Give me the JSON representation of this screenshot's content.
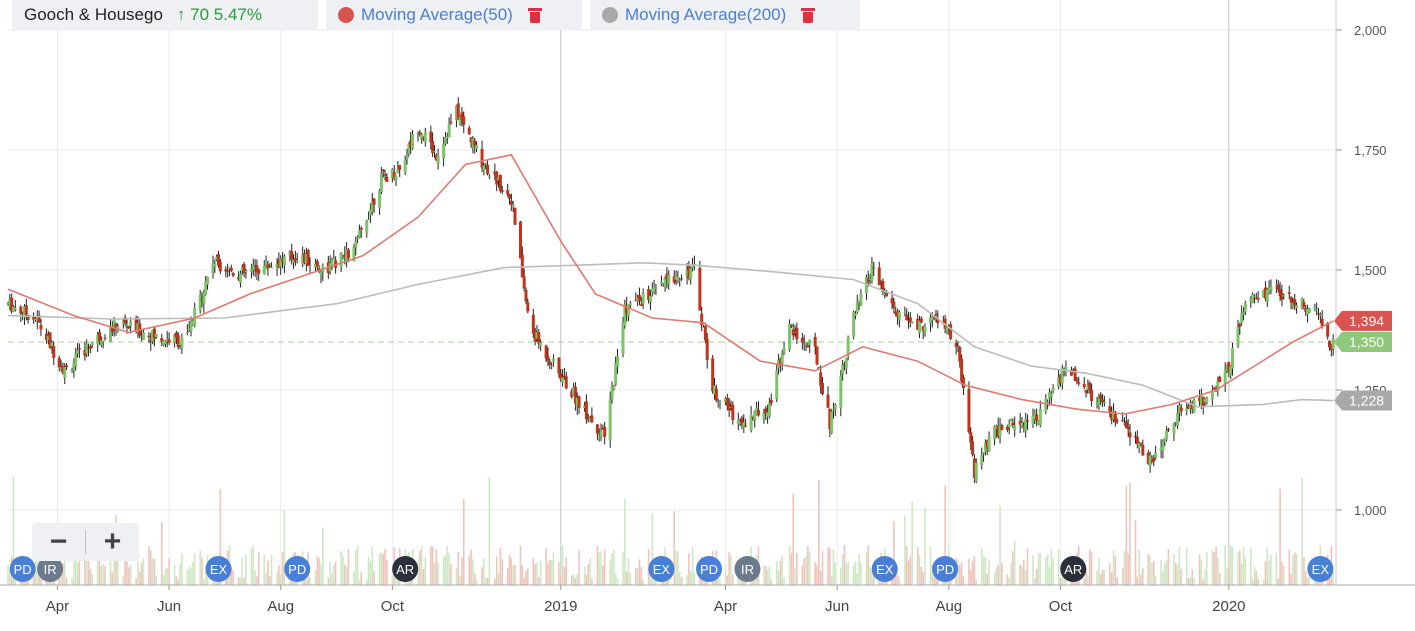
{
  "header": {
    "symbol": "Gooch & Housego",
    "change": "↑ 70 5.47%",
    "ma50_label": "Moving Average(50)",
    "ma200_label": "Moving Average(200)"
  },
  "colors": {
    "up": "#7ec36a",
    "down": "#c0341b",
    "ma50": "#e07a70",
    "ma200": "#bcbcbc",
    "price_badge": "#8fc87a",
    "ma50_badge": "#d9534f",
    "ma200_badge": "#a9a9a9",
    "event_blue": "#4a7fd6",
    "event_slate": "#6c7a8e",
    "event_dark": "#2a2f3a"
  },
  "icons": {
    "zoom_out": "minus-icon",
    "zoom_in": "plus-icon",
    "delete": "trash-icon"
  },
  "zoom": {
    "minus": "−",
    "plus": "+"
  },
  "chart_data": {
    "type": "candlestick",
    "title": "Gooch & Housego",
    "ylim": [
      850,
      2060
    ],
    "y_ticks": [
      {
        "value": 1000,
        "label": "1,000"
      },
      {
        "value": 1250,
        "label": "1,250"
      },
      {
        "value": 1500,
        "label": "1,500"
      },
      {
        "value": 1750,
        "label": "1,750"
      },
      {
        "value": 2000,
        "label": "2,000"
      }
    ],
    "x_ticks": [
      {
        "date": "2018-04",
        "label": "Apr"
      },
      {
        "date": "2018-06",
        "label": "Jun"
      },
      {
        "date": "2018-08",
        "label": "Aug"
      },
      {
        "date": "2018-10",
        "label": "Oct"
      },
      {
        "date": "2019-01",
        "label": "2019"
      },
      {
        "date": "2019-04",
        "label": "Apr"
      },
      {
        "date": "2019-06",
        "label": "Jun"
      },
      {
        "date": "2019-08",
        "label": "Aug"
      },
      {
        "date": "2019-10",
        "label": "Oct"
      },
      {
        "date": "2020-01",
        "label": "2020"
      }
    ],
    "xlim": [
      "2018-03-05",
      "2020-02-28"
    ],
    "year_lines": [
      "2019-01-01",
      "2020-01-01"
    ],
    "grid": true,
    "price_path": [
      [
        "2018-03-05",
        1430
      ],
      [
        "2018-03-20",
        1400
      ],
      [
        "2018-04-05",
        1290
      ],
      [
        "2018-04-20",
        1350
      ],
      [
        "2018-05-05",
        1390
      ],
      [
        "2018-05-25",
        1360
      ],
      [
        "2018-06-10",
        1350
      ],
      [
        "2018-06-25",
        1520
      ],
      [
        "2018-07-10",
        1490
      ],
      [
        "2018-07-25",
        1510
      ],
      [
        "2018-08-10",
        1530
      ],
      [
        "2018-08-25",
        1500
      ],
      [
        "2018-09-10",
        1540
      ],
      [
        "2018-09-25",
        1690
      ],
      [
        "2018-10-05",
        1710
      ],
      [
        "2018-10-15",
        1800
      ],
      [
        "2018-10-25",
        1740
      ],
      [
        "2018-11-05",
        1830
      ],
      [
        "2018-11-20",
        1720
      ],
      [
        "2018-12-05",
        1650
      ],
      [
        "2018-12-15",
        1380
      ],
      [
        "2018-12-30",
        1290
      ],
      [
        "2019-01-10",
        1230
      ],
      [
        "2019-01-25",
        1150
      ],
      [
        "2019-02-05",
        1420
      ],
      [
        "2019-02-20",
        1450
      ],
      [
        "2019-03-05",
        1490
      ],
      [
        "2019-03-15",
        1500
      ],
      [
        "2019-03-25",
        1250
      ],
      [
        "2019-04-10",
        1180
      ],
      [
        "2019-04-25",
        1220
      ],
      [
        "2019-05-05",
        1380
      ],
      [
        "2019-05-20",
        1330
      ],
      [
        "2019-05-28",
        1180
      ],
      [
        "2019-06-10",
        1400
      ],
      [
        "2019-06-20",
        1500
      ],
      [
        "2019-07-01",
        1420
      ],
      [
        "2019-07-15",
        1380
      ],
      [
        "2019-07-25",
        1400
      ],
      [
        "2019-08-05",
        1350
      ],
      [
        "2019-08-15",
        1080
      ],
      [
        "2019-08-25",
        1160
      ],
      [
        "2019-09-05",
        1180
      ],
      [
        "2019-09-20",
        1200
      ],
      [
        "2019-10-05",
        1300
      ],
      [
        "2019-10-20",
        1230
      ],
      [
        "2019-11-05",
        1170
      ],
      [
        "2019-11-20",
        1100
      ],
      [
        "2019-12-05",
        1210
      ],
      [
        "2019-12-20",
        1230
      ],
      [
        "2020-01-01",
        1300
      ],
      [
        "2020-01-10",
        1430
      ],
      [
        "2020-01-25",
        1460
      ],
      [
        "2020-02-10",
        1430
      ],
      [
        "2020-02-20",
        1400
      ],
      [
        "2020-02-26",
        1330
      ],
      [
        "2020-02-27",
        1350
      ]
    ],
    "ma50": [
      [
        "2018-03-05",
        1460
      ],
      [
        "2018-04-10",
        1405
      ],
      [
        "2018-05-10",
        1370
      ],
      [
        "2018-06-15",
        1400
      ],
      [
        "2018-07-15",
        1450
      ],
      [
        "2018-08-15",
        1490
      ],
      [
        "2018-09-15",
        1530
      ],
      [
        "2018-10-15",
        1610
      ],
      [
        "2018-11-10",
        1720
      ],
      [
        "2018-12-05",
        1740
      ],
      [
        "2019-01-01",
        1560
      ],
      [
        "2019-01-20",
        1450
      ],
      [
        "2019-02-20",
        1400
      ],
      [
        "2019-03-20",
        1390
      ],
      [
        "2019-04-20",
        1310
      ],
      [
        "2019-05-20",
        1290
      ],
      [
        "2019-06-15",
        1340
      ],
      [
        "2019-07-15",
        1310
      ],
      [
        "2019-08-10",
        1260
      ],
      [
        "2019-09-10",
        1230
      ],
      [
        "2019-10-10",
        1210
      ],
      [
        "2019-11-05",
        1200
      ],
      [
        "2019-12-01",
        1220
      ],
      [
        "2019-12-25",
        1250
      ],
      [
        "2020-01-15",
        1300
      ],
      [
        "2020-02-05",
        1350
      ],
      [
        "2020-02-27",
        1394
      ]
    ],
    "ma200": [
      [
        "2018-03-05",
        1405
      ],
      [
        "2018-05-01",
        1398
      ],
      [
        "2018-07-01",
        1400
      ],
      [
        "2018-09-01",
        1430
      ],
      [
        "2018-10-15",
        1470
      ],
      [
        "2018-12-01",
        1505
      ],
      [
        "2019-01-10",
        1510
      ],
      [
        "2019-02-15",
        1515
      ],
      [
        "2019-03-15",
        1510
      ],
      [
        "2019-05-01",
        1495
      ],
      [
        "2019-06-10",
        1480
      ],
      [
        "2019-07-15",
        1430
      ],
      [
        "2019-08-15",
        1340
      ],
      [
        "2019-09-15",
        1300
      ],
      [
        "2019-10-15",
        1285
      ],
      [
        "2019-11-15",
        1260
      ],
      [
        "2019-12-15",
        1215
      ],
      [
        "2020-01-20",
        1220
      ],
      [
        "2020-02-10",
        1230
      ],
      [
        "2020-02-27",
        1228
      ]
    ],
    "price_markers": [
      {
        "value": 1394,
        "label": "1,394",
        "role": "ma50"
      },
      {
        "value": 1350,
        "label": "1,350",
        "role": "price"
      },
      {
        "value": 1228,
        "label": "1,228",
        "role": "ma200"
      }
    ],
    "reference_line": 1350,
    "events": [
      {
        "date": "2018-03-13",
        "label": "PD",
        "style": "blue"
      },
      {
        "date": "2018-03-28",
        "label": "IR",
        "style": "slate"
      },
      {
        "date": "2018-06-28",
        "label": "EX",
        "style": "blue"
      },
      {
        "date": "2018-08-10",
        "label": "PD",
        "style": "blue"
      },
      {
        "date": "2018-10-08",
        "label": "AR",
        "style": "dark"
      },
      {
        "date": "2019-02-25",
        "label": "EX",
        "style": "blue"
      },
      {
        "date": "2019-03-23",
        "label": "PD",
        "style": "blue"
      },
      {
        "date": "2019-04-13",
        "label": "IR",
        "style": "slate"
      },
      {
        "date": "2019-06-27",
        "label": "EX",
        "style": "blue"
      },
      {
        "date": "2019-07-30",
        "label": "PD",
        "style": "blue"
      },
      {
        "date": "2019-10-08",
        "label": "AR",
        "style": "dark"
      },
      {
        "date": "2020-02-20",
        "label": "EX",
        "style": "blue"
      }
    ]
  }
}
